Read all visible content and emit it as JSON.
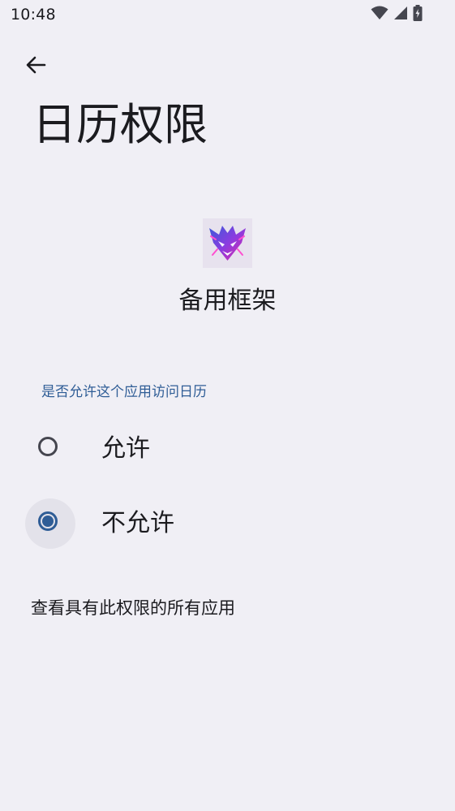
{
  "status_bar": {
    "time": "10:48",
    "icons": [
      "wifi-icon",
      "cellular-signal-icon",
      "battery-charging-icon"
    ]
  },
  "header": {
    "back_icon": "arrow-back-icon",
    "title": "日历权限"
  },
  "app": {
    "icon": "app-logo-icon",
    "name": "备用框架"
  },
  "permission": {
    "caption": "是否允许这个应用访问日历",
    "options": [
      {
        "label": "允许",
        "selected": false
      },
      {
        "label": "不允许",
        "selected": true
      }
    ]
  },
  "footer": {
    "all_apps_link": "查看具有此权限的所有应用"
  },
  "colors": {
    "background": "#f0eff5",
    "accent": "#2f5d96",
    "text": "#1b1b1f"
  }
}
